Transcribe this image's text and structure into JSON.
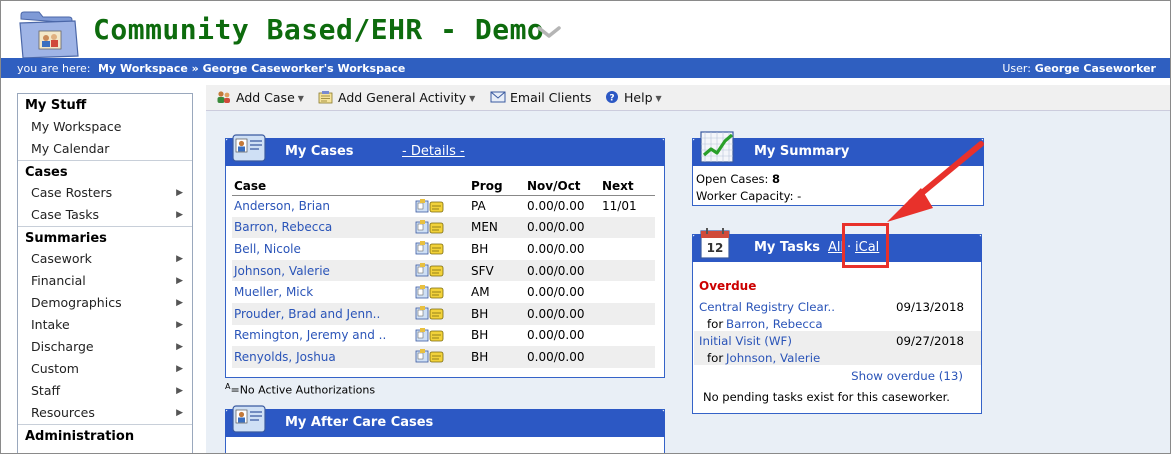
{
  "header": {
    "app_title": "Community Based/EHR - Demo"
  },
  "breadcrumb": {
    "label": "you are here:",
    "path": "My Workspace » George Caseworker's Workspace",
    "user_label": "User:",
    "user_name": "George Caseworker"
  },
  "sidebar": {
    "sections": [
      {
        "title": "My Stuff",
        "items": [
          {
            "label": "My Workspace",
            "has_arrow": false
          },
          {
            "label": "My Calendar",
            "has_arrow": false
          }
        ]
      },
      {
        "title": "Cases",
        "items": [
          {
            "label": "Case Rosters",
            "has_arrow": true
          },
          {
            "label": "Case Tasks",
            "has_arrow": true
          }
        ]
      },
      {
        "title": "Summaries",
        "items": [
          {
            "label": "Casework",
            "has_arrow": true
          },
          {
            "label": "Financial",
            "has_arrow": true
          },
          {
            "label": "Demographics",
            "has_arrow": true
          },
          {
            "label": "Intake",
            "has_arrow": true
          },
          {
            "label": "Discharge",
            "has_arrow": true
          },
          {
            "label": "Custom",
            "has_arrow": true
          },
          {
            "label": "Staff",
            "has_arrow": true
          },
          {
            "label": "Resources",
            "has_arrow": true
          }
        ]
      },
      {
        "title": "Administration",
        "items": []
      }
    ]
  },
  "toolbar": {
    "add_case": "Add Case",
    "add_activity": "Add General Activity",
    "email_clients": "Email Clients",
    "help": "Help"
  },
  "my_cases": {
    "title": "My Cases",
    "details_link": "- Details -",
    "columns": [
      "Case",
      "Prog",
      "Nov/Oct",
      "Next"
    ],
    "rows": [
      {
        "name": "Anderson, Brian",
        "prog": "PA",
        "amount": "0.00/0.00",
        "next": "11/01"
      },
      {
        "name": "Barron, Rebecca",
        "prog": "MEN",
        "amount": "0.00/0.00",
        "next": ""
      },
      {
        "name": "Bell, Nicole",
        "prog": "BH",
        "amount": "0.00/0.00",
        "next": ""
      },
      {
        "name": "Johnson, Valerie",
        "prog": "SFV",
        "amount": "0.00/0.00",
        "next": ""
      },
      {
        "name": "Mueller, Mick",
        "prog": "AM",
        "amount": "0.00/0.00",
        "next": ""
      },
      {
        "name": "Prouder, Brad and Jenn..",
        "prog": "BH",
        "amount": "0.00/0.00",
        "next": ""
      },
      {
        "name": "Remington, Jeremy and ..",
        "prog": "BH",
        "amount": "0.00/0.00",
        "next": ""
      },
      {
        "name": "Renyolds, Joshua",
        "prog": "BH",
        "amount": "0.00/0.00",
        "next": ""
      }
    ],
    "footnote_sup": "A",
    "footnote": "=No Active Authorizations"
  },
  "after_care": {
    "title": "My After Care Cases"
  },
  "my_summary": {
    "title": "My Summary",
    "open_cases_label": "Open Cases:",
    "open_cases_value": "8",
    "capacity_label": "Worker Capacity:",
    "capacity_value": "-"
  },
  "my_tasks": {
    "title": "My Tasks",
    "all_link": "All",
    "separator": "·",
    "ical_link": "iCal",
    "overdue_label": "Overdue",
    "tasks": [
      {
        "name": "Central Registry Clear..",
        "date": "09/13/2018",
        "for_label": "for",
        "client": "Barron, Rebecca"
      },
      {
        "name": "Initial Visit (WF)",
        "date": "09/27/2018",
        "for_label": "for",
        "client": "Johnson, Valerie"
      }
    ],
    "show_overdue": "Show overdue (13)",
    "no_pending": "No pending tasks exist for this caseworker."
  },
  "colors": {
    "title_green": "#0d6b0d",
    "header_blue": "#2c58c4",
    "link_blue": "#2a54b8",
    "overdue_red": "#cc0000",
    "annotation_red": "#e8312b"
  }
}
